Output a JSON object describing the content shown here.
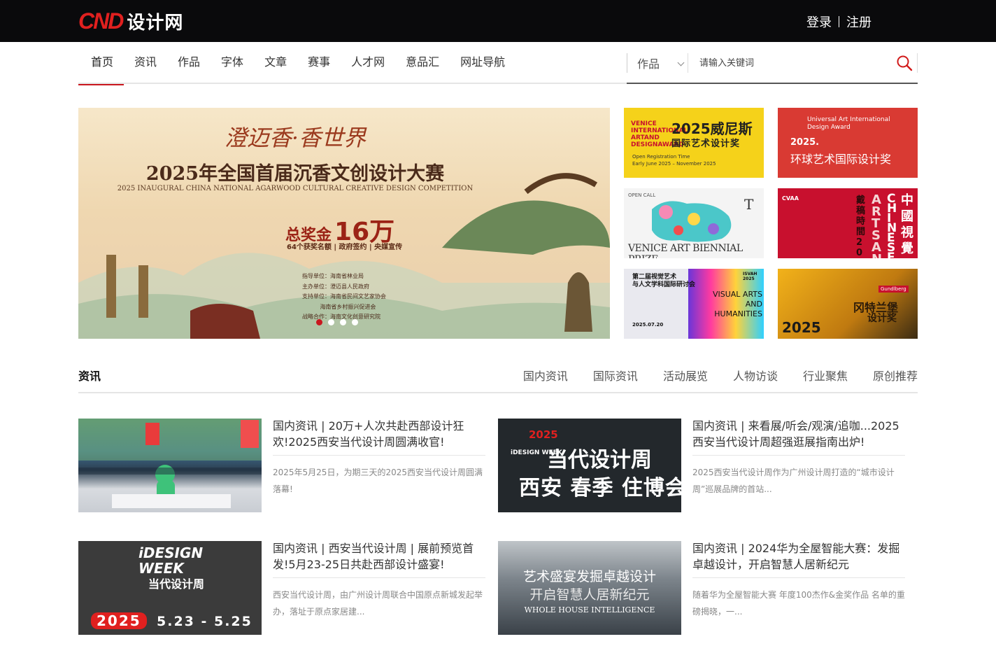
{
  "header": {
    "logo_mark": "CND",
    "logo_text": "设计网",
    "login": "登录",
    "register": "注册"
  },
  "nav": {
    "items": [
      "首页",
      "资讯",
      "作品",
      "字体",
      "文章",
      "赛事",
      "人才网",
      "意品汇",
      "网址导航"
    ],
    "active_index": 0
  },
  "search": {
    "category": "作品",
    "placeholder": "请输入关键词"
  },
  "banner": {
    "headline": "澄迈香·香世界",
    "title": "2025年全国首届沉香文创设计大赛",
    "subtitle": "2025 INAUGURAL CHINA NATIONAL AGARWOOD CULTURAL CREATIVE DESIGN COMPETITION",
    "prize_prefix": "总奖金",
    "prize_amount": "16万",
    "prize_sub": "64个获奖名额 | 政府签约 | 央媒宣传",
    "organizers": "指导单位：海南省林业局\n主办单位：澄迈县人民政府\n支持单位：海南省民间文艺家协会\n          海南省乡村振兴促进会\n战略合作：海南文化创意研究院",
    "slide_count": 4,
    "active_slide": 0
  },
  "thumbs": [
    {
      "title": "2025威尼斯",
      "title2": "国际艺术设计奖",
      "brand": "VENICE INTERNATIONAL ARTAND DESIGNAWARD",
      "note": "Open Registration Time",
      "note2": "Early June 2025 – November 2025"
    },
    {
      "brand": "Universal Art International Design Award",
      "year": "2025.",
      "title": "环球艺术国际设计奖"
    },
    {
      "label": "OPEN CALL",
      "title": "VENICE ART BIENNIAL PRIZE"
    },
    {
      "brand": "CVAA",
      "title": "中國視覺",
      "title2": "ARTS AN",
      "title3": "CHINESE",
      "title4": "戴稿時間 202"
    },
    {
      "title": "第二届视觉艺术",
      "title2": "与人文学科国际研讨会",
      "en": "VISUAL ARTS AND HUMANITIES",
      "tag": "ISVAH 2025",
      "date": "2025.07.20"
    },
    {
      "year": "2025",
      "title": "冈特兰堡",
      "title2": "设计奖",
      "brand": "Gundlberg"
    }
  ],
  "section": {
    "title": "资讯",
    "tabs": [
      "国内资讯",
      "国际资讯",
      "活动展览",
      "人物访谈",
      "行业聚焦",
      "原创推荐"
    ]
  },
  "articles": [
    {
      "title": "国内资讯 | 20万+人次共赴西部设计狂欢!2025西安当代设计周圆满收官!",
      "desc": "2025年5月25日，为期三天的2025西安当代设计周圆满落幕!"
    },
    {
      "title": "国内资讯 | 来看展/听会/观演/追咖...2025西安当代设计周超强逛展指南出炉!",
      "desc": "2025西安当代设计周作为广州设计周打造的“城市设计周”巡展品牌的首站...",
      "img_year": "2025",
      "img_line1": "iDESIGN WEEK",
      "img_line2": "当代设计周",
      "img_line3": "西安 春季 住博会"
    },
    {
      "title": "国内资讯 | 西安当代设计周 | 展前预览首发!5月23-25日共赴西部设计盛宴!",
      "desc": "西安当代设计周，由广州设计周联合中国原点新城发起举办，落址于原点家居建...",
      "img_line1": "iDESIGN WEEK",
      "img_line2": "当代设计周",
      "img_year": "2025",
      "img_dates": "5.23 - 5.25"
    },
    {
      "title": "国内资讯 | 2024华为全屋智能大赛：发掘卓越设计，开启智慧人居新纪元",
      "desc": "随着华为全屋智能大赛 年度100杰作&金奖作品 名单的重磅揭晓，一...",
      "img_line1": "艺术盛宴发掘卓越设计",
      "img_line2": "开启智慧人居新纪元",
      "img_line3": "WHOLE HOUSE INTELLIGENCE"
    }
  ],
  "colors": {
    "accent": "#c9171e",
    "topbar": "#0a0a0c"
  }
}
